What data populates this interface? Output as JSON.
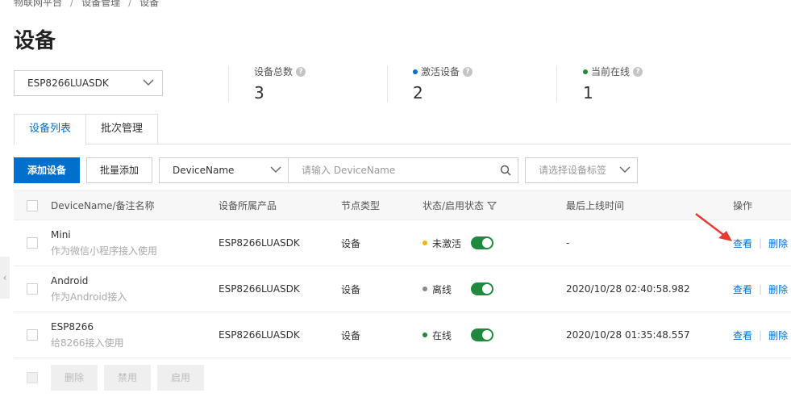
{
  "breadcrumb": [
    "物联网平台",
    "设备管理",
    "设备"
  ],
  "page_title": "设备",
  "product_select": {
    "value": "ESP8266LUASDK"
  },
  "stats": [
    {
      "label": "设备总数",
      "value": "3",
      "dot_color": null
    },
    {
      "label": "激活设备",
      "value": "2",
      "dot_color": "#0070cc"
    },
    {
      "label": "当前在线",
      "value": "1",
      "dot_color": "#1f8a3f"
    }
  ],
  "help_glyph": "?",
  "tabs": [
    {
      "label": "设备列表",
      "active": true
    },
    {
      "label": "批次管理",
      "active": false
    }
  ],
  "toolbar": {
    "add_device": "添加设备",
    "batch_add": "批量添加",
    "filter_field": "DeviceName",
    "search_placeholder": "请输入 DeviceName",
    "tag_placeholder": "请选择设备标签"
  },
  "table": {
    "headers": {
      "name": "DeviceName/备注名称",
      "product": "设备所属产品",
      "node_type": "节点类型",
      "status": "状态/启用状态",
      "last_online": "最后上线时间",
      "actions": "操作"
    },
    "rows": [
      {
        "name": "Mini",
        "note": "作为微信小程序接入使用",
        "product": "ESP8266LUASDK",
        "node_type": "设备",
        "status": "未激活",
        "status_color": "#f5b400",
        "enabled": true,
        "last_online": "-",
        "view": "查看",
        "delete": "删除"
      },
      {
        "name": "Android",
        "note": "作为Android接入",
        "product": "ESP8266LUASDK",
        "node_type": "设备",
        "status": "离线",
        "status_color": "#8a8a8a",
        "enabled": true,
        "last_online": "2020/10/28 02:40:58.982",
        "view": "查看",
        "delete": "删除"
      },
      {
        "name": "ESP8266",
        "note": "给8266接入使用",
        "product": "ESP8266LUASDK",
        "node_type": "设备",
        "status": "在线",
        "status_color": "#1f8a3f",
        "enabled": true,
        "last_online": "2020/10/28 01:35:48.557",
        "view": "查看",
        "delete": "删除"
      }
    ]
  },
  "footer": {
    "delete": "删除",
    "disable": "禁用",
    "enable": "启用"
  },
  "side_handle_glyph": "‹",
  "colors": {
    "primary": "#0070cc",
    "annotation": "#e83a30"
  }
}
